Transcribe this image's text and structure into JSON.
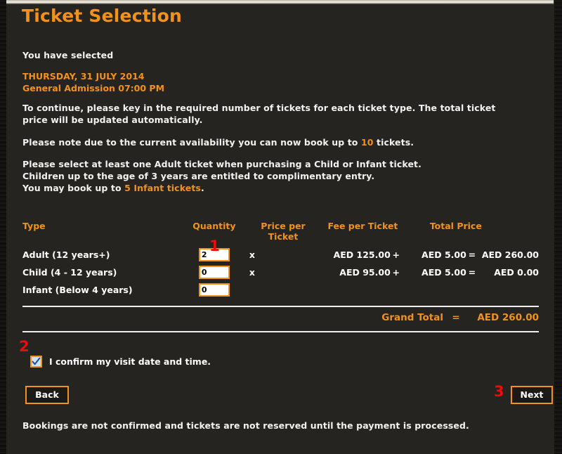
{
  "colors": {
    "accent": "#f2911b",
    "panel_bg": "#262420",
    "text": "#ffffff",
    "marker_red": "#f00a0a",
    "rule": "#efefef",
    "input_bg": "#ffffff",
    "checkbox_fill": "#cfe3f7"
  },
  "page": {
    "title": "Ticket Selection"
  },
  "selection": {
    "label": "You have selected",
    "date": "THURSDAY, 31 JULY 2014",
    "session": "General Admission 07:00 PM"
  },
  "instructions": {
    "intro": "To continue, please key in the required number of tickets for each ticket type. The total ticket price will be updated automatically.",
    "availability_prefix": "Please note due to the current availability you can now book up to ",
    "availability_count": "10",
    "availability_suffix": " tickets.",
    "rule_adult": "Please select at least one Adult ticket when purchasing a Child or Infant ticket.",
    "rule_children": "Children up to the age of 3 years are entitled to complimentary entry.",
    "rule_infant_prefix": "You may book up to ",
    "rule_infant_count": "5 Infant tickets",
    "rule_infant_suffix": "."
  },
  "table": {
    "headers": {
      "type": "Type",
      "quantity": "Quantity",
      "price_per_ticket": "Price per Ticket",
      "price_per_ticket_line1": "Price per",
      "price_per_ticket_line2": "Ticket",
      "fee_per_ticket": "Fee per Ticket",
      "total_price": "Total Price"
    },
    "rows": [
      {
        "type": "Adult (12 years+)",
        "quantity": "2",
        "multiply_sign": "x",
        "price": "AED  125.00",
        "plus_sign": "+",
        "fee": "AED  5.00",
        "equals_sign": "=",
        "total": "AED  260.00"
      },
      {
        "type": "Child (4 - 12 years)",
        "quantity": "0",
        "multiply_sign": "x",
        "price": "AED  95.00",
        "plus_sign": "+",
        "fee": "AED  5.00",
        "equals_sign": "=",
        "total": "AED  0.00"
      },
      {
        "type": "Infant (Below 4 years)",
        "quantity": "0",
        "multiply_sign": "",
        "price": "",
        "plus_sign": "",
        "fee": "",
        "equals_sign": "",
        "total": ""
      }
    ]
  },
  "grand_total": {
    "label": "Grand Total",
    "equals_sign": "=",
    "amount": "AED  260.00"
  },
  "confirm": {
    "label": "I confirm my visit date and time.",
    "checked": true
  },
  "buttons": {
    "back": "Back",
    "next": "Next"
  },
  "footnote": "Bookings are not confirmed and tickets are not reserved until the payment is processed.",
  "markers": {
    "one": "1",
    "two": "2",
    "three": "3"
  }
}
